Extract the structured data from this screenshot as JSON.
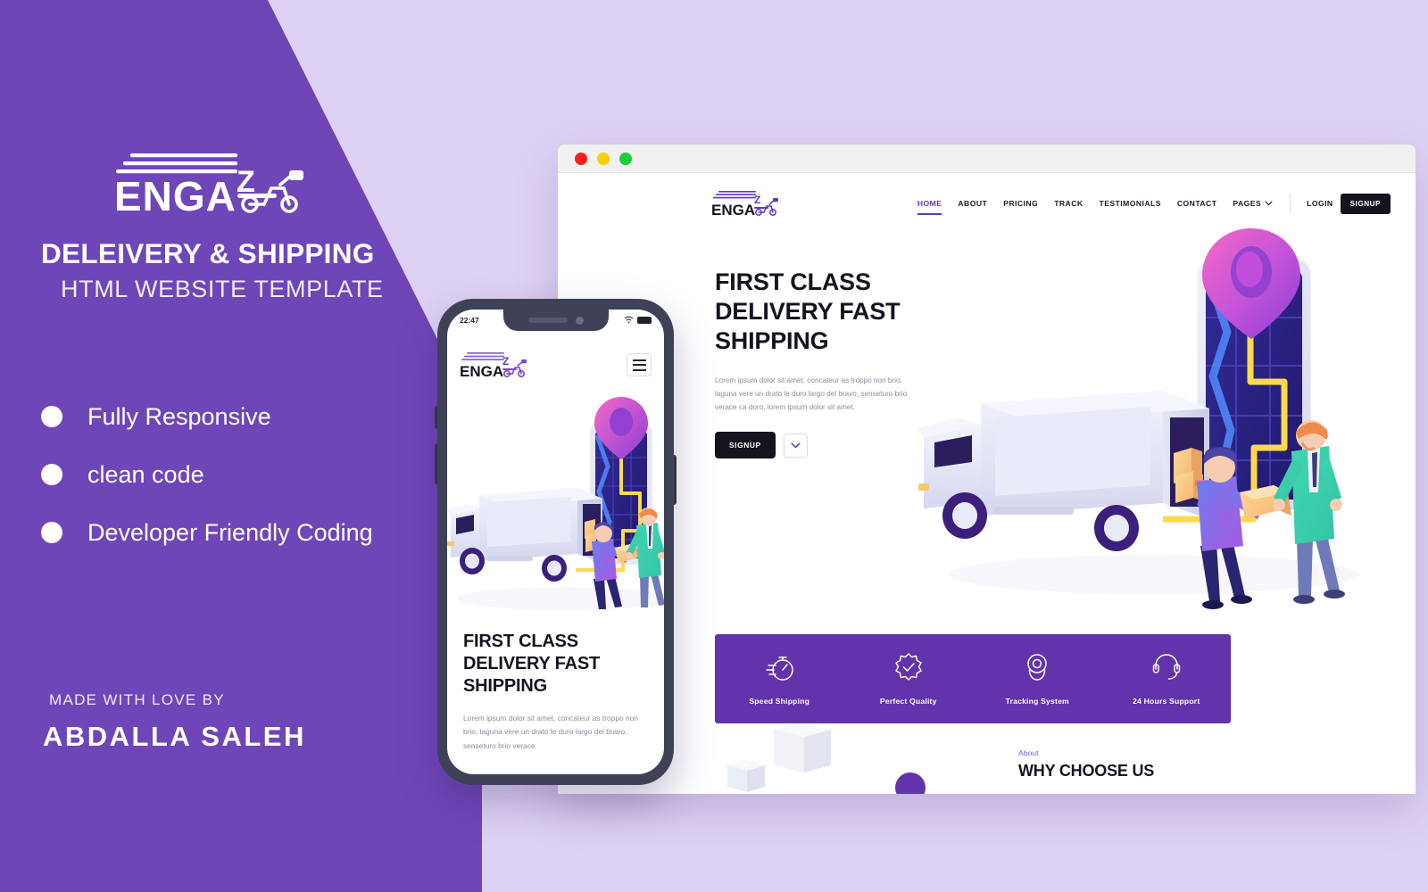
{
  "colors": {
    "brand_purple": "#6f46b8",
    "light_lavender": "#ddd2f4",
    "strip_purple": "#6333ab",
    "dark": "#14141e",
    "nav_active": "#6438b8"
  },
  "promo": {
    "logo_wordmark": "ENGA",
    "logo_z": "Z",
    "logo_icon": "scooter-icon",
    "title": "DELEIVERY & SHIPPING",
    "subtitle": "HTML WEBSITE TEMPLATE",
    "features": [
      {
        "label": "Fully Responsive"
      },
      {
        "label": "clean code"
      },
      {
        "label": "Developer Friendly Coding"
      }
    ],
    "credit_label": "MADE WITH LOVE BY",
    "credit_name": "ABDALLA SALEH"
  },
  "browser": {
    "traffic_lights": [
      "close-red",
      "minimize-yellow",
      "maximize-green"
    ]
  },
  "site": {
    "logo_wordmark": "ENGA",
    "logo_z": "Z",
    "nav": [
      {
        "label": "HOME",
        "active": true
      },
      {
        "label": "ABOUT",
        "active": false
      },
      {
        "label": "PRICING",
        "active": false
      },
      {
        "label": "TRACK",
        "active": false
      },
      {
        "label": "TESTIMONIALS",
        "active": false
      },
      {
        "label": "CONTACT",
        "active": false
      },
      {
        "label": "PAGES",
        "active": false,
        "has_caret": true
      }
    ],
    "login_label": "LOGIN",
    "signup_label": "SIGNUP",
    "hero": {
      "heading": "FIRST CLASS DELIVERY FAST SHIPPING",
      "paragraph": "Lorem ipsum dolor sit amet, concateur as troppo non brio, laguna vere un drato le duro largo del bravo, senseturo brio verace ca doro, lorem ipsum dolor sit amet.",
      "cta_label": "SIGNUP",
      "more_icon": "chevron-down-icon",
      "illustration": "isometric-delivery-truck-map-pin-illustration"
    },
    "feature_strip": [
      {
        "icon": "stopwatch-icon",
        "label": "Speed Shipping"
      },
      {
        "icon": "badge-check-icon",
        "label": "Perfect Quality"
      },
      {
        "icon": "map-pin-icon",
        "label": "Tracking System"
      },
      {
        "icon": "headset-icon",
        "label": "24 Hours Support"
      }
    ],
    "about": {
      "kicker": "About",
      "title": "WHY CHOOSE US"
    }
  },
  "phone": {
    "status_time": "22:47",
    "status_icons": [
      "wifi-icon",
      "battery-icon"
    ],
    "logo_wordmark": "ENGA",
    "logo_z": "Z",
    "menu_icon": "hamburger-menu-icon",
    "hero_heading": "FIRST CLASS DELIVERY FAST SHIPPING",
    "hero_paragraph": "Lorem ipsum dolor sit amet, concateur as troppo non brio, laguna vere un drato le duro largo del bravo, senseturo brio verace",
    "illustration": "isometric-delivery-truck-map-pin-illustration"
  }
}
